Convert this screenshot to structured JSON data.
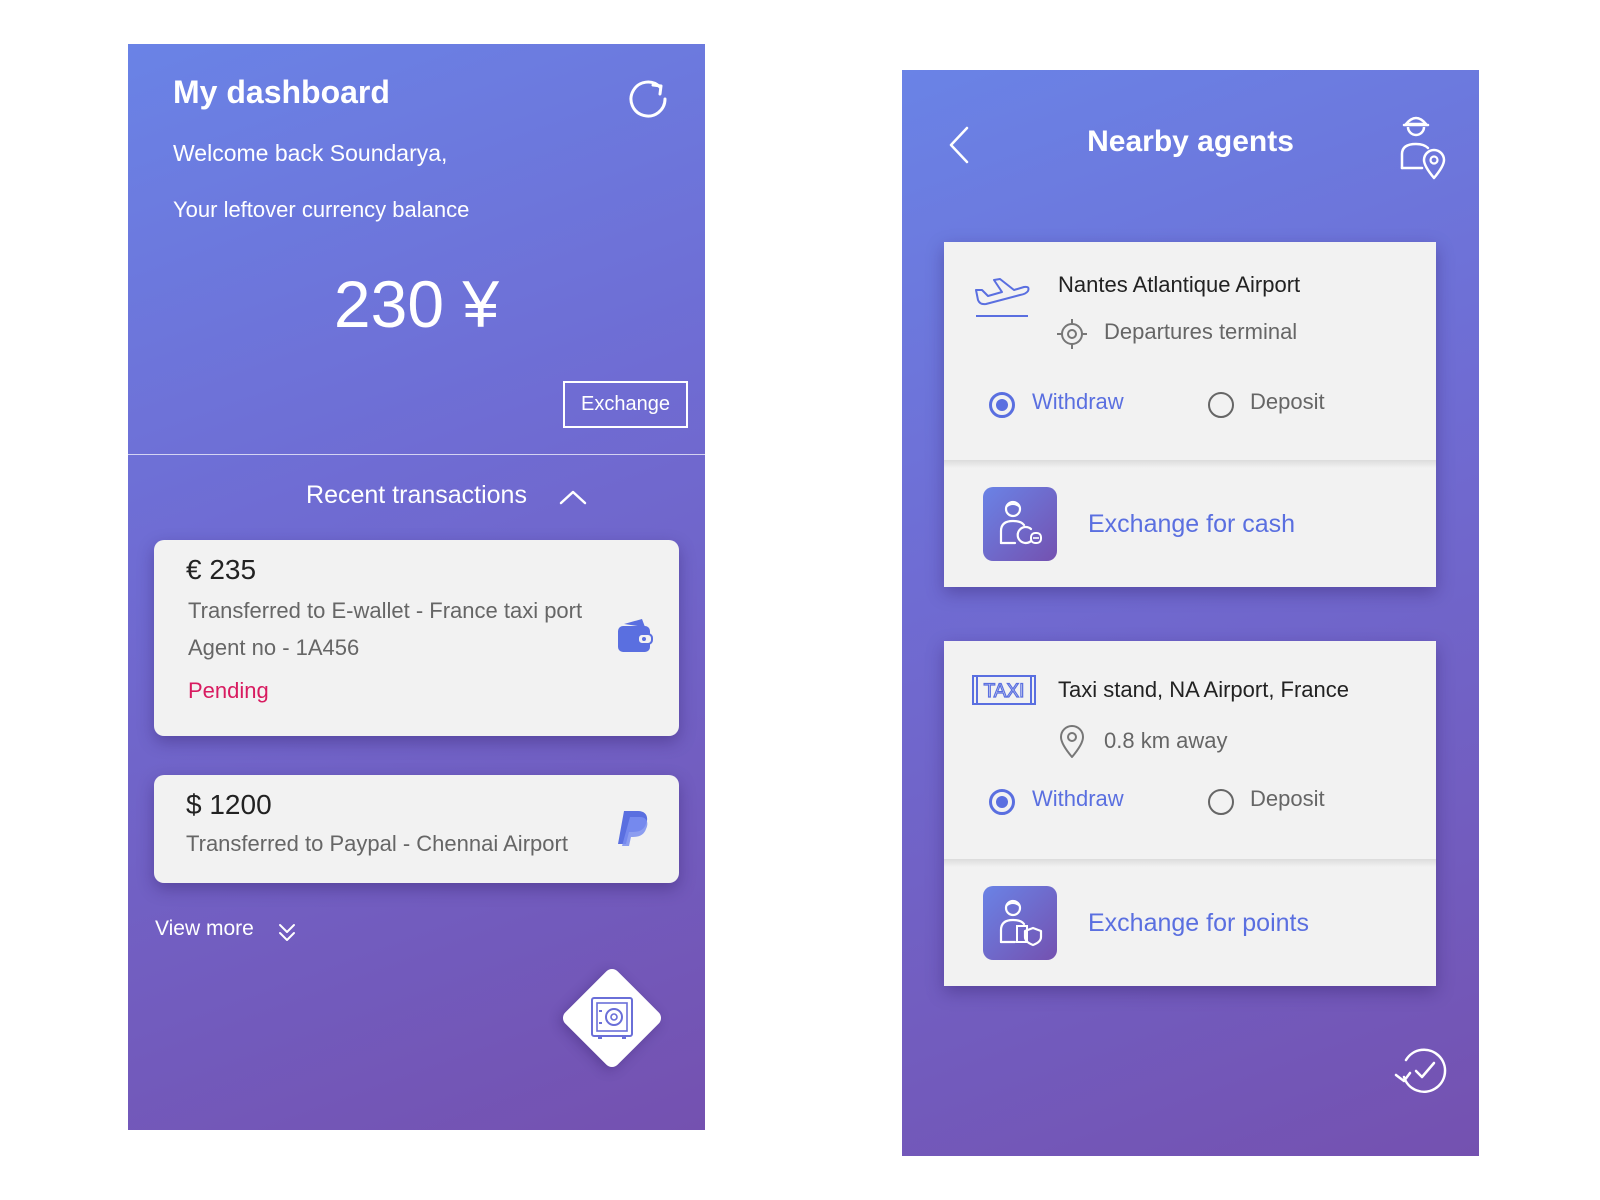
{
  "dashboard": {
    "title": "My dashboard",
    "welcome": "Welcome back Soundarya,",
    "balance_label": "Your leftover currency balance",
    "balance": "230 ¥",
    "exchange_label": "Exchange",
    "recent_label": "Recent transactions",
    "transactions": [
      {
        "amount": "€ 235",
        "description": "Transferred to E-wallet - France taxi port",
        "agent": "Agent no - 1A456",
        "status": "Pending",
        "icon": "wallet-icon"
      },
      {
        "amount": "$ 1200",
        "description": "Transferred to Paypal - Chennai Airport",
        "icon": "paypal-icon"
      }
    ],
    "view_more": "View more"
  },
  "agents": {
    "title": "Nearby agents",
    "cards": [
      {
        "place": "Nantes Atlantique Airport",
        "sub": "Departures terminal",
        "place_icon": "airplane-icon",
        "sub_icon": "target-icon",
        "withdraw_label": "Withdraw",
        "deposit_label": "Deposit",
        "selected": "Withdraw",
        "exchange_label": "Exchange for cash"
      },
      {
        "place": "Taxi stand, NA Airport, France",
        "sub": "0.8 km away",
        "place_icon": "taxi-icon",
        "taxi_text": "TAXI",
        "sub_icon": "location-pin-icon",
        "withdraw_label": "Withdraw",
        "deposit_label": "Deposit",
        "selected": "Withdraw",
        "exchange_label": "Exchange for points"
      }
    ]
  },
  "colors": {
    "gradient_start": "#6a83e6",
    "gradient_end": "#7451b0",
    "accent": "#5a6fe0",
    "pending": "#d81b60",
    "card": "#f2f2f2"
  }
}
